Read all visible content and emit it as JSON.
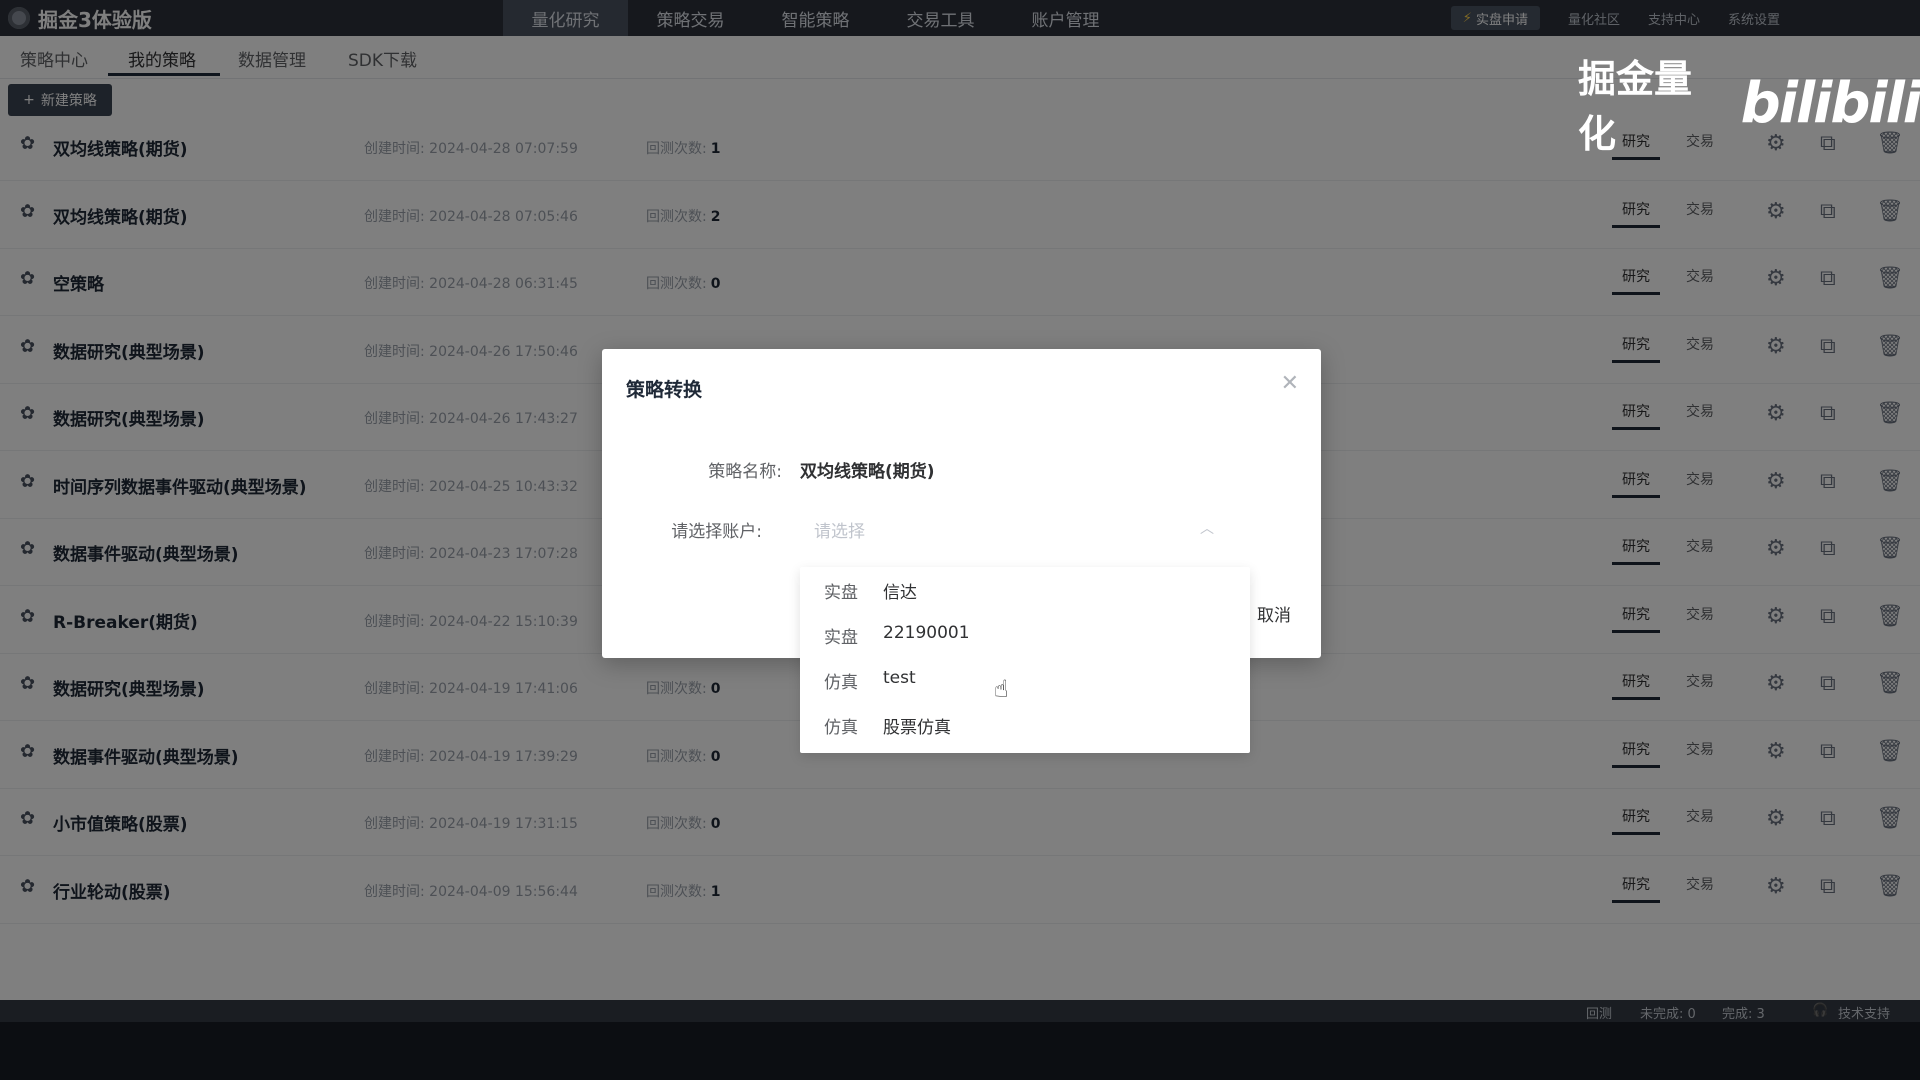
{
  "app": {
    "title": "掘金3体验版",
    "nav": [
      "量化研究",
      "策略交易",
      "智能策略",
      "交易工具",
      "账户管理"
    ],
    "active_nav": "量化研究",
    "apply_label": "实盘申请",
    "right_links": [
      "量化社区",
      "支持中心",
      "系统设置"
    ]
  },
  "subnav": {
    "tabs": [
      "策略中心",
      "我的策略",
      "数据管理",
      "SDK下载"
    ],
    "active": "我的策略"
  },
  "new_strategy_label": "新建策略",
  "row_labels": {
    "created_prefix": "创建时间:",
    "backtest_prefix": "回测次数:",
    "research": "研究",
    "trade": "交易"
  },
  "strategies": [
    {
      "name": "双均线策略(期货)",
      "created": "2024-04-28 07:07:59",
      "count": "1"
    },
    {
      "name": "双均线策略(期货)",
      "created": "2024-04-28 07:05:46",
      "count": "2"
    },
    {
      "name": "空策略",
      "created": "2024-04-28 06:31:45",
      "count": "0"
    },
    {
      "name": "数据研究(典型场景)",
      "created": "2024-04-26 17:50:46",
      "count": ""
    },
    {
      "name": "数据研究(典型场景)",
      "created": "2024-04-26 17:43:27",
      "count": ""
    },
    {
      "name": "时间序列数据事件驱动(典型场景)",
      "created": "2024-04-25 10:43:32",
      "count": ""
    },
    {
      "name": "数据事件驱动(典型场景)",
      "created": "2024-04-23 17:07:28",
      "count": ""
    },
    {
      "name": "R-Breaker(期货)",
      "created": "2024-04-22 15:10:39",
      "count": ""
    },
    {
      "name": "数据研究(典型场景)",
      "created": "2024-04-19 17:41:06",
      "count": "0"
    },
    {
      "name": "数据事件驱动(典型场景)",
      "created": "2024-04-19 17:39:29",
      "count": "0"
    },
    {
      "name": "小市值策略(股票)",
      "created": "2024-04-19 17:31:15",
      "count": "0"
    },
    {
      "name": "行业轮动(股票)",
      "created": "2024-04-09 15:56:44",
      "count": "1"
    }
  ],
  "statusbar": {
    "backtest": "回测",
    "pending": "未完成: 0",
    "done": "完成: 3",
    "support": "技术支持"
  },
  "watermark": {
    "text": "掘金量化",
    "logo": "bilibili"
  },
  "dialog": {
    "title": "策略转换",
    "name_label": "策略名称:",
    "name_value": "双均线策略(期货)",
    "account_label": "请选择账户:",
    "account_placeholder": "请选择",
    "cancel": "取消"
  },
  "dropdown": [
    {
      "type": "实盘",
      "name": "信达"
    },
    {
      "type": "实盘",
      "name": "22190001"
    },
    {
      "type": "仿真",
      "name": "test"
    },
    {
      "type": "仿真",
      "name": "股票仿真"
    }
  ]
}
